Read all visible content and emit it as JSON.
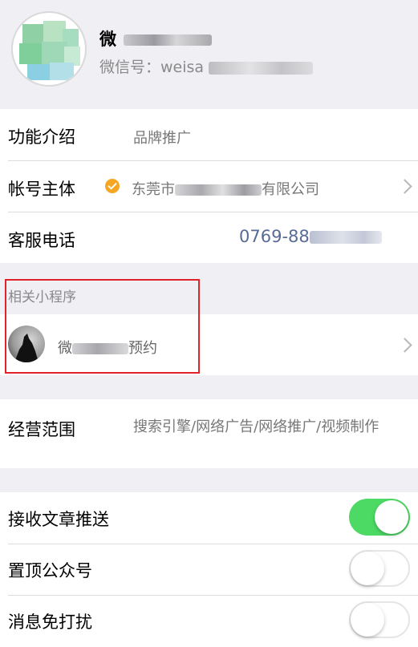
{
  "profile": {
    "name": "微",
    "id_label": "微信号：weisa"
  },
  "info": {
    "intro_label": "功能介绍",
    "intro_value": "品牌推广",
    "owner_label": "帐号主体",
    "owner_value_prefix": "东莞市",
    "owner_value_suffix": "有限公司",
    "phone_label": "客服电话",
    "phone_value": "0769-88"
  },
  "mini_programs": {
    "section_title": "相关小程序",
    "item_prefix": "微",
    "item_suffix": "预约"
  },
  "business": {
    "label": "经营范围",
    "value": "搜索引擎/网络广告/网络推广/视频制作"
  },
  "settings": {
    "items": [
      {
        "label": "接收文章推送",
        "on": true
      },
      {
        "label": "置顶公众号",
        "on": false
      },
      {
        "label": "消息免打扰",
        "on": false
      }
    ]
  },
  "colors": {
    "toggle_on": "#4cd964",
    "verified": "#f5a623",
    "phone_link": "#576b95",
    "highlight_box": "#e0232b"
  },
  "icons": {
    "verified": "check-circle-icon",
    "chevron": "chevron-right-icon"
  }
}
